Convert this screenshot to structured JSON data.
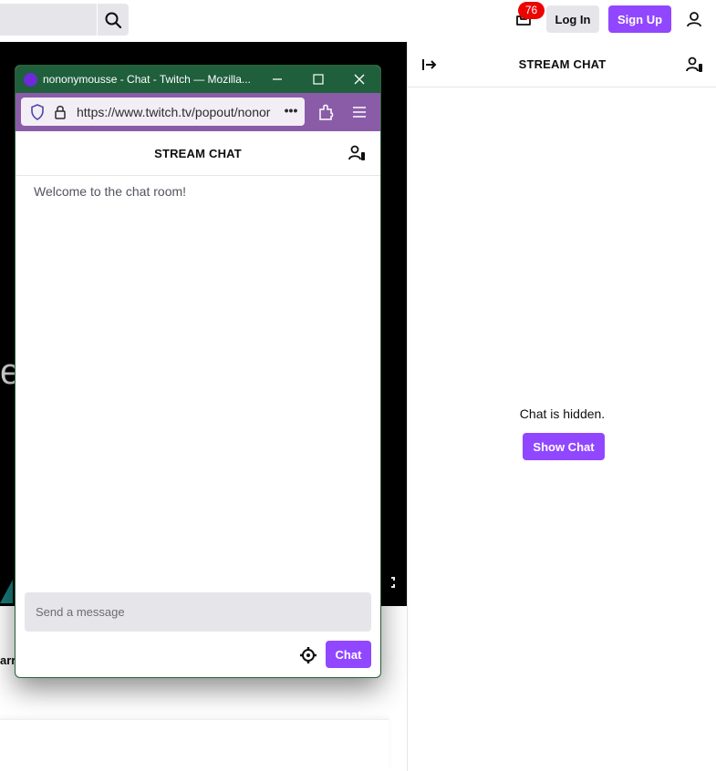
{
  "topbar": {
    "search_placeholder": "",
    "inbox_count": "76",
    "login_label": "Log In",
    "signup_label": "Sign Up"
  },
  "video": {
    "overlay_letter": "e"
  },
  "below_video": {
    "text_fragment": "arr"
  },
  "side_chat": {
    "title": "STREAM CHAT",
    "hidden_text": "Chat is hidden.",
    "show_button": "Show Chat"
  },
  "popup": {
    "window_title": "nononymousse - Chat - Twitch — Mozilla...",
    "url": "https://www.twitch.tv/popout/nonor",
    "chat_title": "STREAM CHAT",
    "welcome": "Welcome to the chat room!",
    "input_placeholder": "Send a message",
    "chat_button": "Chat"
  },
  "colors": {
    "accent": "#9147ff",
    "badge": "#eb0400",
    "popup_titlebar": "#1f5f3c",
    "popup_navbar": "#8a5ca8"
  },
  "icons": [
    "search-icon",
    "inbox-icon",
    "user-icon",
    "collapse-icon",
    "users-icon",
    "shield-icon",
    "lock-icon",
    "extensions-icon",
    "menu-icon",
    "settings-icon",
    "fullscreen-icon"
  ]
}
